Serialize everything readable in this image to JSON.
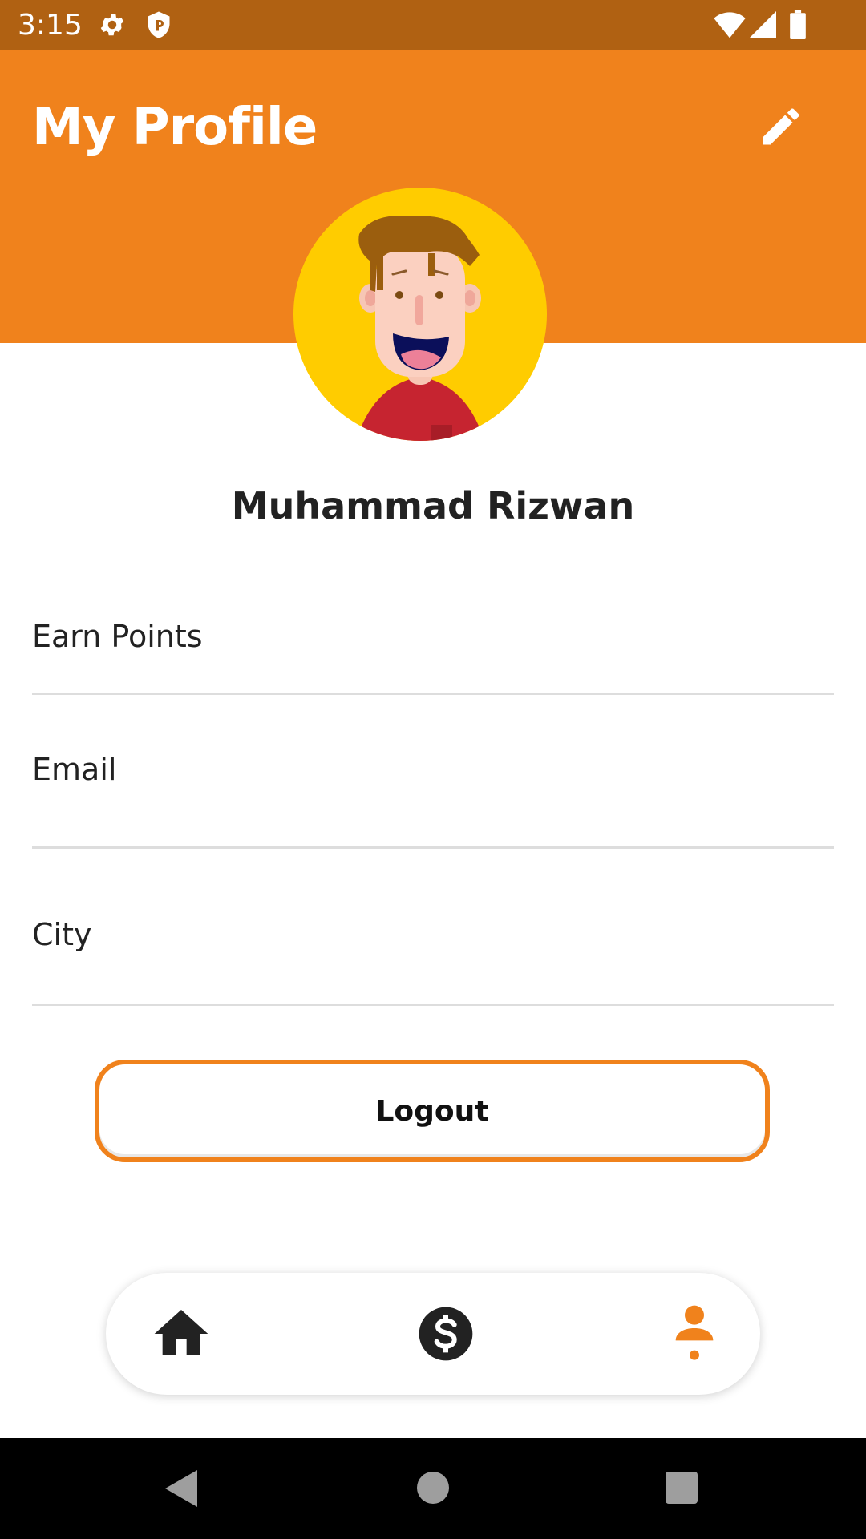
{
  "status_bar": {
    "time": "3:15",
    "icons": [
      "gear-icon",
      "shield-icon",
      "wifi-icon",
      "signal-icon",
      "battery-icon"
    ]
  },
  "header": {
    "title": "My Profile",
    "edit_icon": "pencil-icon",
    "background_color": "#F0821C"
  },
  "profile": {
    "name": "Muhammad Rizwan",
    "avatar": "cartoon-boy-avatar"
  },
  "fields": [
    {
      "label": "Earn Points"
    },
    {
      "label": "Email"
    },
    {
      "label": "City"
    }
  ],
  "logout": {
    "label": "Logout",
    "border_color": "#F0821C"
  },
  "bottom_nav": {
    "items": [
      {
        "icon": "home-icon",
        "active": false
      },
      {
        "icon": "dollar-icon",
        "active": false
      },
      {
        "icon": "person-icon",
        "active": true
      }
    ],
    "active_color": "#F0821C"
  },
  "system_nav": {
    "icons": [
      "back-icon",
      "home-circle-icon",
      "recents-icon"
    ]
  }
}
